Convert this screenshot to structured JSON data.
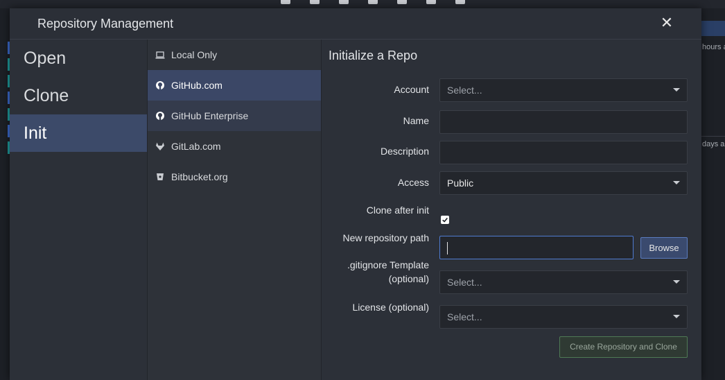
{
  "window": {
    "title": "Repository Management",
    "close_icon": "close-icon"
  },
  "background": {
    "row1_text": "hours a",
    "row2_text": "days a"
  },
  "nav": {
    "items": [
      {
        "label": "Open",
        "active": false
      },
      {
        "label": "Clone",
        "active": false
      },
      {
        "label": "Init",
        "active": true
      }
    ]
  },
  "providers": {
    "items": [
      {
        "label": "Local Only",
        "icon": "laptop-icon"
      },
      {
        "label": "GitHub.com",
        "icon": "github-icon",
        "selected": true
      },
      {
        "label": "GitHub Enterprise",
        "icon": "github-icon"
      },
      {
        "label": "GitLab.com",
        "icon": "gitlab-icon"
      },
      {
        "label": "Bitbucket.org",
        "icon": "bitbucket-icon"
      }
    ]
  },
  "form": {
    "section_title": "Initialize a Repo",
    "account": {
      "label": "Account",
      "placeholder": "Select..."
    },
    "name": {
      "label": "Name",
      "value": ""
    },
    "description": {
      "label": "Description",
      "value": ""
    },
    "access": {
      "label": "Access",
      "value": "Public"
    },
    "clone_after_init": {
      "label": "Clone after init",
      "checked": true
    },
    "repo_path": {
      "label": "New repository path",
      "value": ""
    },
    "browse_label": "Browse",
    "gitignore": {
      "label_line1": ".gitignore Template",
      "label_line2": "(optional)",
      "placeholder": "Select..."
    },
    "license": {
      "label": "License (optional)",
      "placeholder": "Select..."
    },
    "create_label": "Create Repository and Clone"
  },
  "colors": {
    "accent": "#3c4a69",
    "focus_border": "#4f7bd1",
    "create_border": "#4f7a55"
  }
}
